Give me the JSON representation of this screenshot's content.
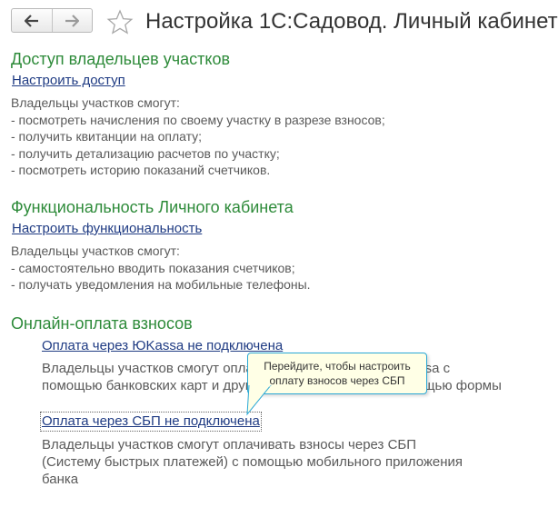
{
  "toolbar": {
    "back_icon": "arrow-left-icon",
    "forward_icon": "arrow-right-icon",
    "favorite_icon": "star-outline-icon"
  },
  "page": {
    "title": "Настройка 1С:Садовод. Личный кабинет"
  },
  "access": {
    "title": "Доступ владельцев участков",
    "link": "Настроить доступ",
    "lines": [
      "Владельцы участков смогут:",
      "- посмотреть начисления по своему участку в разрезе взносов;",
      "- получить квитанции на оплату;",
      "- получить детализацию расчетов по участку;",
      "- посмотреть историю показаний счетчиков."
    ]
  },
  "functionality": {
    "title": "Функциональность Личного кабинета",
    "link": "Настроить функциональность",
    "lines": [
      "Владельцы участков смогут:",
      "- самостоятельно вводить показания счетчиков;",
      "- получать уведомления на мобильные телефоны."
    ]
  },
  "payment": {
    "title": "Онлайн-оплата взносов",
    "yookassa_link": "Оплата через ЮKassa не подключена",
    "yookassa_lines": [
      "Владельцы участков смогут оплачивать взносы через ЮKassa с",
      "помощью банковских карт и других способов оплаты с помощью формы"
    ],
    "sbp_link": "Оплата через СБП не подключена",
    "sbp_lines": [
      "Владельцы участков смогут оплачивать взносы через СБП",
      "(Систему быстрых платежей) с помощью мобильного приложения",
      "банка"
    ]
  },
  "tooltip": {
    "lines": [
      "Перейдите, чтобы настроить",
      "оплату взносов через СБП"
    ]
  },
  "colors": {
    "section_title": "#2e8b3a",
    "link": "#1f3b83",
    "description": "#5a5a5a",
    "tooltip_border": "#2aa8d6",
    "tooltip_bg": "#ffffe6"
  }
}
